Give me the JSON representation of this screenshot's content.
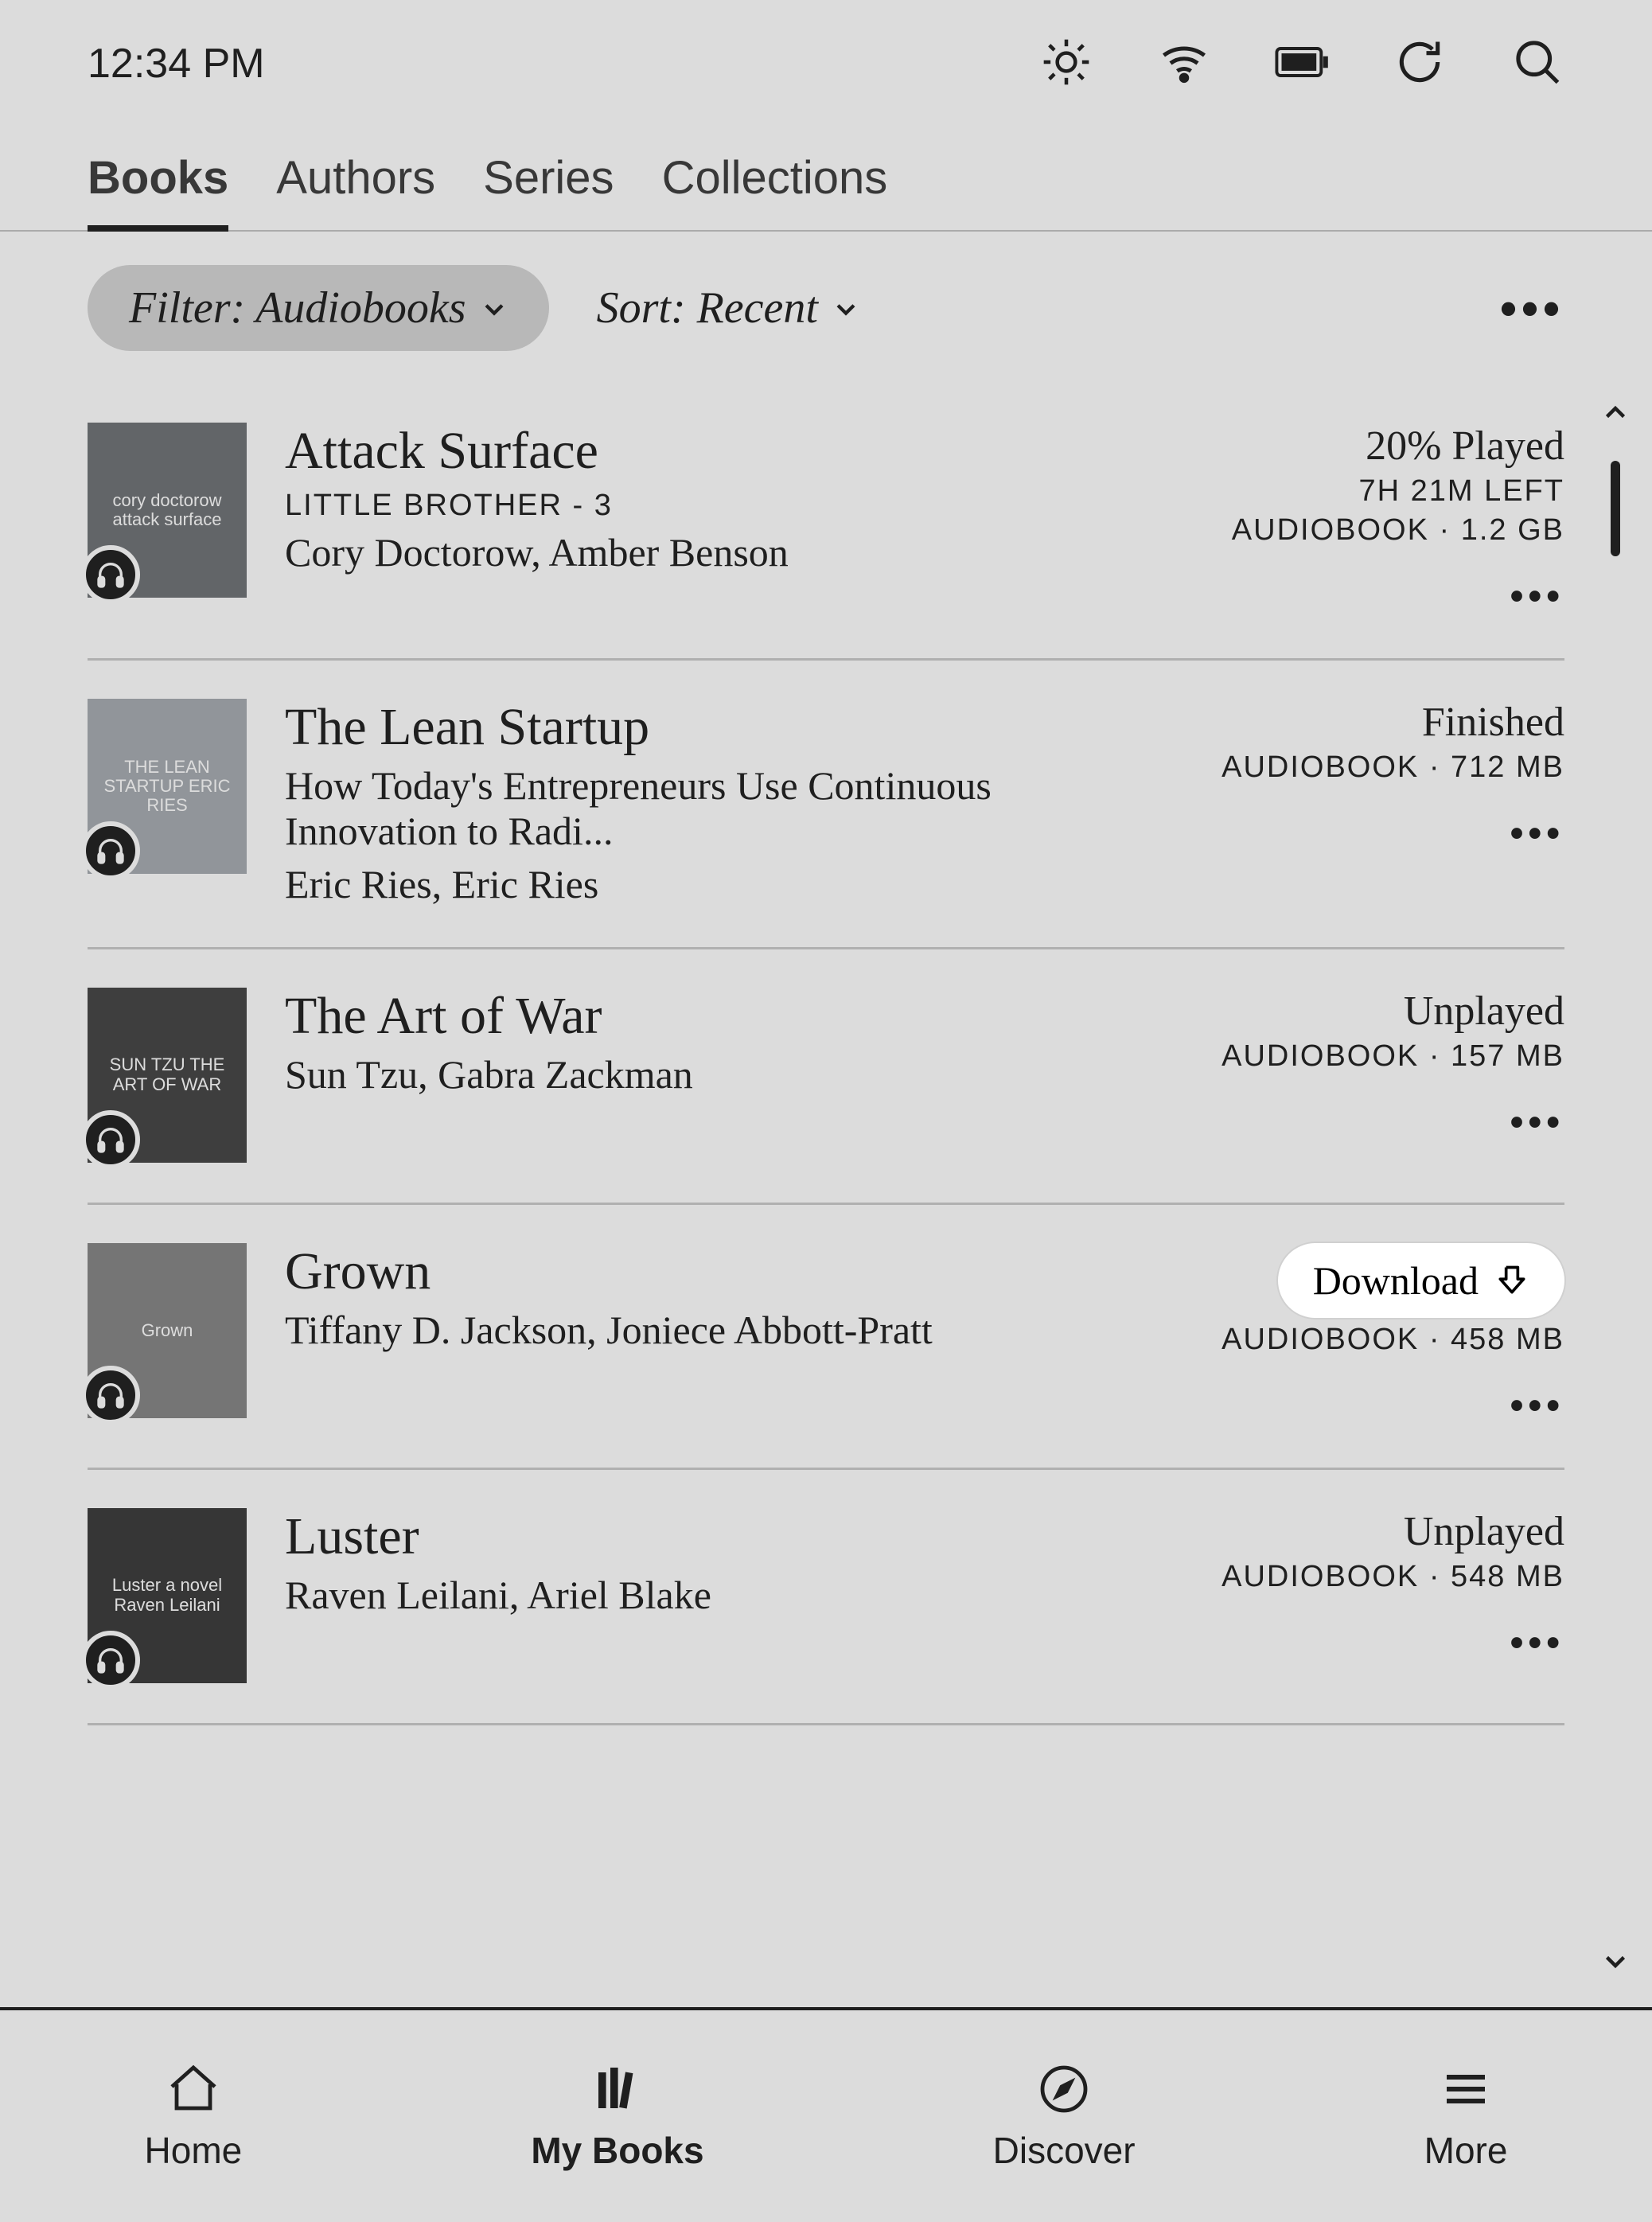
{
  "status": {
    "time": "12:34 PM"
  },
  "tabs": [
    "Books",
    "Authors",
    "Series",
    "Collections"
  ],
  "active_tab_index": 0,
  "filter": {
    "label": "Filter: Audiobooks"
  },
  "sort": {
    "label": "Sort: Recent"
  },
  "books": [
    {
      "title": "Attack Surface",
      "series": "LITTLE BROTHER - 3",
      "subtitle": "",
      "author": "Cory Doctorow, Amber Benson",
      "status": "20% Played",
      "time_left": "7H 21M LEFT",
      "type_size": "AUDIOBOOK · 1.2 GB",
      "cover_text": "cory doctorow\nattack surface",
      "cover_bg": "#5b5f63",
      "download": false
    },
    {
      "title": "The Lean Startup",
      "series": "",
      "subtitle": "How Today's Entrepreneurs Use Continuous Innovation to Radi...",
      "author": "Eric Ries, Eric Ries",
      "status": "Finished",
      "time_left": "",
      "type_size": "AUDIOBOOK · 712 MB",
      "cover_text": "THE LEAN STARTUP\nERIC RIES",
      "cover_bg": "#9aa0a6",
      "download": false
    },
    {
      "title": "The Art of War",
      "series": "",
      "subtitle": "",
      "author": "Sun Tzu, Gabra Zackman",
      "status": "Unplayed",
      "time_left": "",
      "type_size": "AUDIOBOOK · 157 MB",
      "cover_text": "SUN TZU\nTHE ART OF WAR",
      "cover_bg": "#2b2b2b",
      "download": false
    },
    {
      "title": "Grown",
      "series": "",
      "subtitle": "",
      "author": "Tiffany D. Jackson, Joniece Abbott-Pratt",
      "status": "",
      "time_left": "",
      "type_size": "AUDIOBOOK · 458 MB",
      "cover_text": "Grown",
      "cover_bg": "#747474",
      "download": true,
      "download_label": "Download"
    },
    {
      "title": "Luster",
      "series": "",
      "subtitle": "",
      "author": "Raven Leilani, Ariel Blake",
      "status": "Unplayed",
      "time_left": "",
      "type_size": "AUDIOBOOK · 548 MB",
      "cover_text": "Luster a novel\nRaven Leilani",
      "cover_bg": "#1f1f1f",
      "download": false
    }
  ],
  "nav": {
    "items": [
      {
        "label": "Home"
      },
      {
        "label": "My Books"
      },
      {
        "label": "Discover"
      },
      {
        "label": "More"
      }
    ],
    "active_index": 1
  }
}
